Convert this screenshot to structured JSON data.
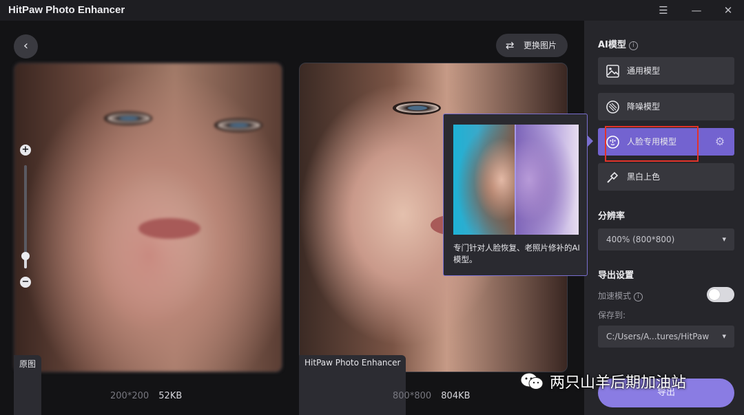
{
  "app": {
    "title": "HitPaw Photo Enhancer"
  },
  "window_controls": {
    "menu_icon": "menu-icon",
    "minimize_icon": "minimize-icon",
    "close_icon": "close-icon"
  },
  "toolbar": {
    "back_icon": "back-arrow-icon",
    "replace_label": "更换图片",
    "replace_icon": "swap-icon"
  },
  "preview": {
    "original_badge": "原图",
    "enhanced_badge": "HitPaw Photo Enhancer",
    "original_dim": "200*200",
    "original_size": "52KB",
    "enhanced_dim": "800*800",
    "enhanced_size": "804KB",
    "zoom_level": 0.12
  },
  "tooltip": {
    "description": "专门针对人脸恢复、老照片修补的AI模型。"
  },
  "sidebar": {
    "ai_model_title": "AI模型",
    "models": [
      {
        "label": "通用模型",
        "icon": "image-icon",
        "active": false
      },
      {
        "label": "降噪模型",
        "icon": "denoise-icon",
        "active": false
      },
      {
        "label": "人脸专用模型",
        "icon": "face-icon",
        "active": true
      },
      {
        "label": "黑白上色",
        "icon": "colorize-icon",
        "active": false
      }
    ],
    "resolution_title": "分辨率",
    "resolution_value": "400% (800*800)",
    "export_title": "导出设置",
    "accel_label": "加速模式",
    "accel_enabled": false,
    "save_to_label": "保存到:",
    "save_path": "C:/Users/A...tures/HitPaw",
    "export_label": "导出"
  },
  "watermark": {
    "text": "两只山羊后期加油站"
  },
  "colors": {
    "accent": "#7363d0",
    "highlight_box": "#e2332a",
    "background": "#161619"
  }
}
